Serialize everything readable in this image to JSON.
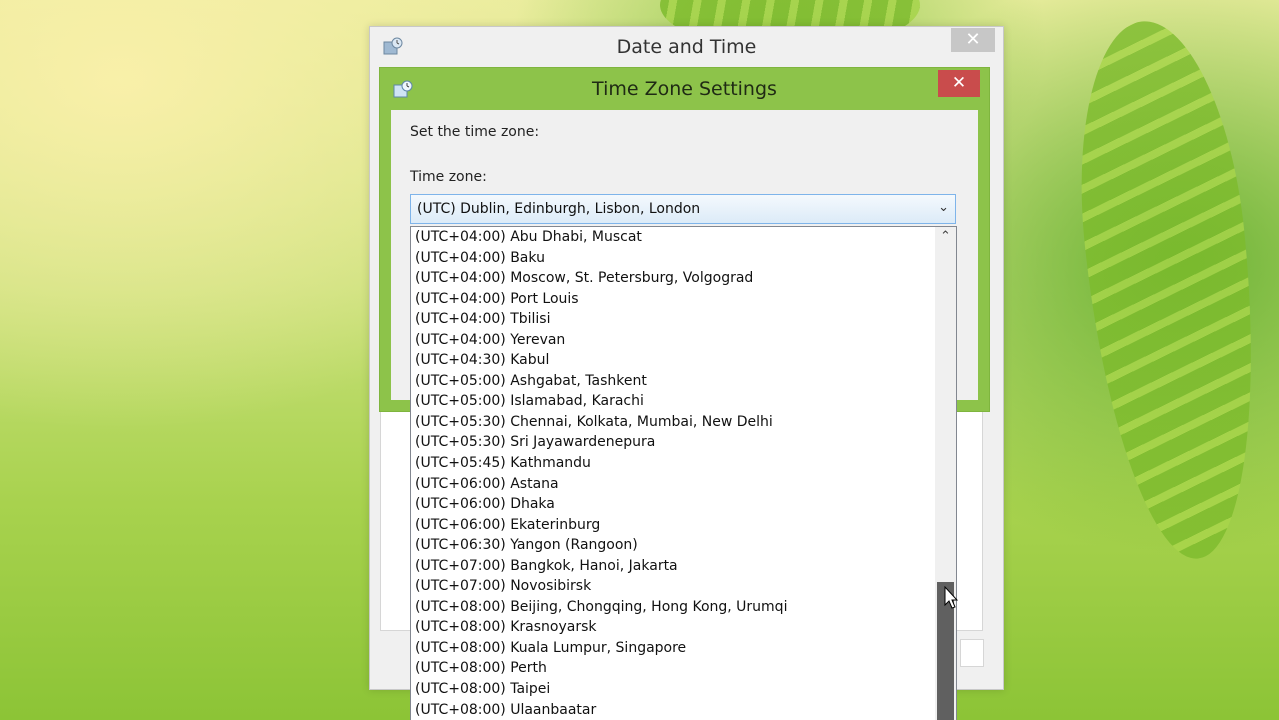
{
  "outer_window": {
    "title": "Date and Time",
    "close_glyph": "✕"
  },
  "tz_dialog": {
    "title": "Time Zone Settings",
    "close_glyph": "✕",
    "set_label": "Set the time zone:",
    "tz_label": "Time zone:",
    "selected": "(UTC) Dublin, Edinburgh, Lisbon, London"
  },
  "timezones": [
    "(UTC+04:00) Abu Dhabi, Muscat",
    "(UTC+04:00) Baku",
    "(UTC+04:00) Moscow, St. Petersburg, Volgograd",
    "(UTC+04:00) Port Louis",
    "(UTC+04:00) Tbilisi",
    "(UTC+04:00) Yerevan",
    "(UTC+04:30) Kabul",
    "(UTC+05:00) Ashgabat, Tashkent",
    "(UTC+05:00) Islamabad, Karachi",
    "(UTC+05:30) Chennai, Kolkata, Mumbai, New Delhi",
    "(UTC+05:30) Sri Jayawardenepura",
    "(UTC+05:45) Kathmandu",
    "(UTC+06:00) Astana",
    "(UTC+06:00) Dhaka",
    "(UTC+06:00) Ekaterinburg",
    "(UTC+06:30) Yangon (Rangoon)",
    "(UTC+07:00) Bangkok, Hanoi, Jakarta",
    "(UTC+07:00) Novosibirsk",
    "(UTC+08:00) Beijing, Chongqing, Hong Kong, Urumqi",
    "(UTC+08:00) Krasnoyarsk",
    "(UTC+08:00) Kuala Lumpur, Singapore",
    "(UTC+08:00) Perth",
    "(UTC+08:00) Taipei",
    "(UTC+08:00) Ulaanbaatar"
  ],
  "colors": {
    "accent_green": "#8dc34a",
    "close_red": "#c94c4c",
    "scroll_thumb": "#606060"
  },
  "icons": {
    "app": "clock-globe-icon",
    "dropdown": "chevron-down-icon",
    "scroll_up": "chevron-up-icon",
    "pointer": "mouse-pointer-icon"
  }
}
